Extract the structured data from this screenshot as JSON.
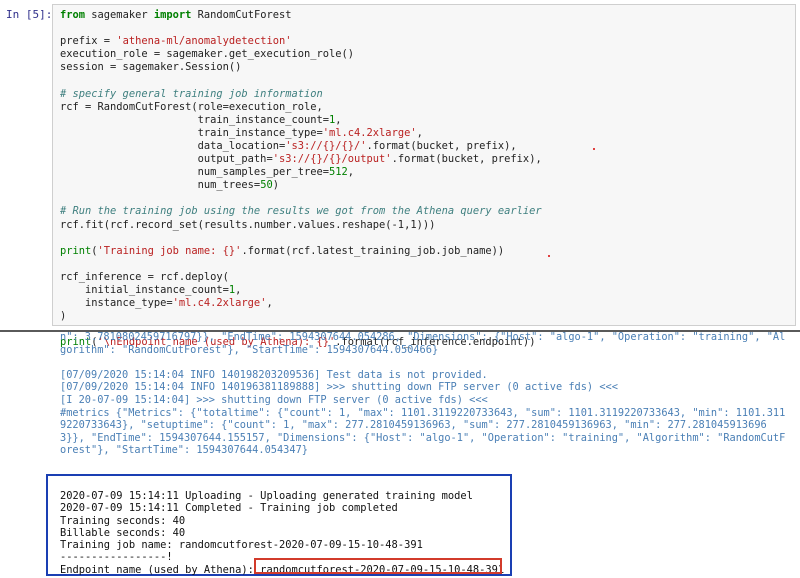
{
  "prompt": "In [5]:",
  "code_lines": [
    "from sagemaker import RandomCutForest",
    "",
    "prefix = 'athena-ml/anomalydetection'",
    "execution_role = sagemaker.get_execution_role()",
    "session = sagemaker.Session()",
    "",
    "# specify general training job information",
    "rcf = RandomCutForest(role=execution_role,",
    "                      train_instance_count=1,",
    "                      train_instance_type='ml.c4.2xlarge',",
    "                      data_location='s3://{}/{}/'.format(bucket, prefix),",
    "                      output_path='s3://{}/{}/output'.format(bucket, prefix),",
    "                      num_samples_per_tree=512,",
    "                      num_trees=50)",
    "",
    "# Run the training job using the results we got from the Athena query earlier",
    "rcf.fit(rcf.record_set(results.number.values.reshape(-1,1)))",
    "",
    "print('Training job name: {}'.format(rcf.latest_training_job.job_name))",
    "",
    "rcf_inference = rcf.deploy(",
    "    initial_instance_count=1,",
    "    instance_type='ml.c4.2xlarge',",
    ")",
    "",
    "print('\\nEndpoint name (used by Athena): {}'.format(rcf_inference.endpoint))"
  ],
  "log_lines": [
    "n\": 3.7810802459716797}}, \"EndTime\": 1594307644.054286, \"Dimensions\": {\"Host\": \"algo-1\", \"Operation\": \"training\", \"Al",
    "gorithm\": \"RandomCutForest\"}, \"StartTime\": 1594307644.050466}",
    "",
    "[07/09/2020 15:14:04 INFO 140198203209536] Test data is not provided.",
    "[07/09/2020 15:14:04 INFO 140196381189888] >>> shutting down FTP server (0 active fds) <<<",
    "[I 20-07-09 15:14:04] >>> shutting down FTP server (0 active fds) <<<",
    "#metrics {\"Metrics\": {\"totaltime\": {\"count\": 1, \"max\": 1101.3119220733643, \"sum\": 1101.3119220733643, \"min\": 1101.311",
    "9220733643}, \"setuptime\": {\"count\": 1, \"max\": 277.2810459136963, \"sum\": 277.2810459136963, \"min\": 277.281045913696",
    "3}}, \"EndTime\": 1594307644.155157, \"Dimensions\": {\"Host\": \"algo-1\", \"Operation\": \"training\", \"Algorithm\": \"RandomCutF",
    "orest\"}, \"StartTime\": 1594307644.054347}"
  ],
  "summary_lines": [
    "2020-07-09 15:14:11 Uploading - Uploading generated training model",
    "2020-07-09 15:14:11 Completed - Training job completed",
    "Training seconds: 40",
    "Billable seconds: 40",
    "Training job name: randomcutforest-2020-07-09-15-10-48-391",
    "-----------------!",
    "Endpoint name (used by Athena): randomcutforest-2020-07-09-15-10-48-391"
  ]
}
